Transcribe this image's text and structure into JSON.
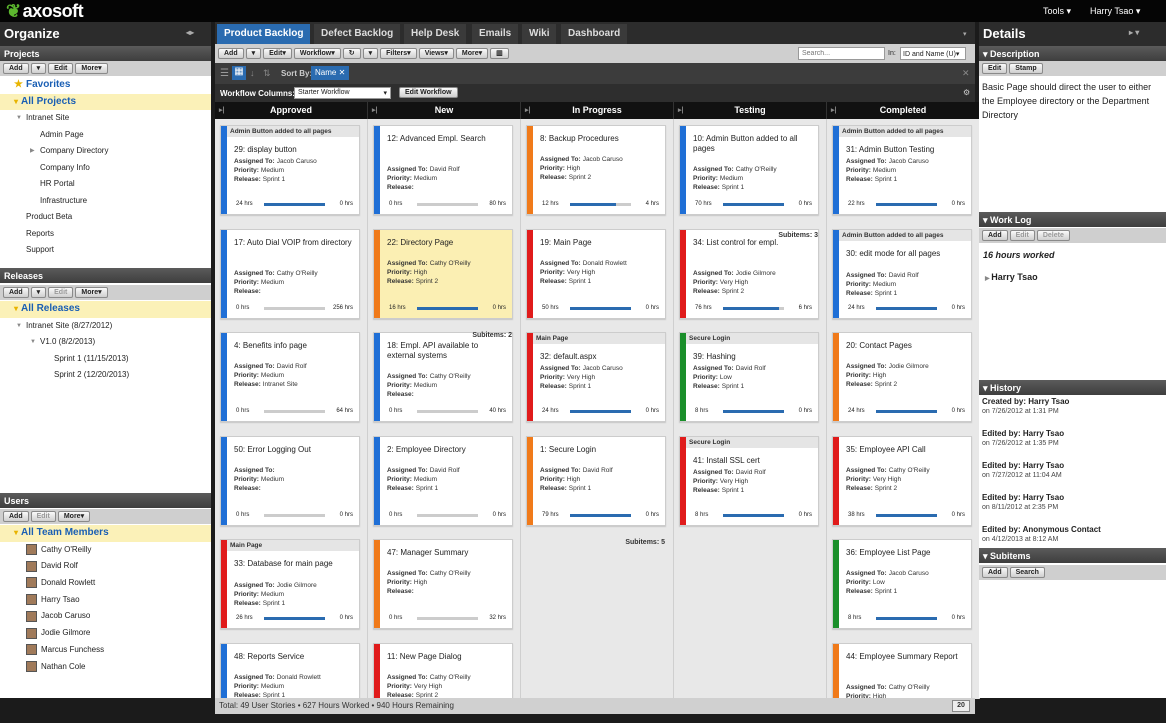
{
  "brand": {
    "name": "axosoft"
  },
  "top": {
    "tools": "Tools",
    "user": "Harry Tsao"
  },
  "organize": {
    "title": "Organize",
    "projects": {
      "title": "Projects",
      "add": "Add",
      "edit": "Edit",
      "more": "More",
      "items": [
        {
          "label": "Favorites",
          "level": 0,
          "style": "fav"
        },
        {
          "label": "All Projects",
          "level": 0,
          "style": "yel"
        },
        {
          "label": "Intranet Site",
          "level": 1
        },
        {
          "label": "Admin Page",
          "level": 2
        },
        {
          "label": "Company Directory",
          "level": 2
        },
        {
          "label": "Company Info",
          "level": 2
        },
        {
          "label": "HR Portal",
          "level": 2
        },
        {
          "label": "Infrastructure",
          "level": 2
        },
        {
          "label": "Product Beta",
          "level": 1
        },
        {
          "label": "Reports",
          "level": 1
        },
        {
          "label": "Support",
          "level": 1
        }
      ]
    },
    "releases": {
      "title": "Releases",
      "add": "Add",
      "edit": "Edit",
      "more": "More",
      "items": [
        {
          "label": "All Releases",
          "level": 0,
          "style": "yel"
        },
        {
          "label": "Intranet Site (8/27/2012)",
          "level": 1
        },
        {
          "label": "V1.0 (8/2/2013)",
          "level": 2
        },
        {
          "label": "Sprint 1 (11/15/2013)",
          "level": 3
        },
        {
          "label": "Sprint 2 (12/20/2013)",
          "level": 3
        }
      ]
    },
    "users": {
      "title": "Users",
      "add": "Add",
      "edit": "Edit",
      "more": "More",
      "items": [
        {
          "label": "All Team Members",
          "level": 0,
          "style": "yel"
        },
        {
          "label": "Cathy O'Reilly",
          "level": 1,
          "avatar": true
        },
        {
          "label": "David Rolf",
          "level": 1,
          "avatar": true
        },
        {
          "label": "Donald Rowlett",
          "level": 1,
          "avatar": true
        },
        {
          "label": "Harry Tsao",
          "level": 1,
          "avatar": true
        },
        {
          "label": "Jacob Caruso",
          "level": 1,
          "avatar": true
        },
        {
          "label": "Jodie Gilmore",
          "level": 1,
          "avatar": true
        },
        {
          "label": "Marcus Funchess",
          "level": 1,
          "avatar": true
        },
        {
          "label": "Nathan Cole",
          "level": 1,
          "avatar": true
        }
      ]
    }
  },
  "tabs": [
    "Product Backlog",
    "Defect Backlog",
    "Help Desk",
    "Emails",
    "Wiki",
    "Dashboard"
  ],
  "toolbar": {
    "add": "Add",
    "edit": "Edit",
    "workflow": "Workflow",
    "filters": "Filters",
    "views": "Views",
    "more": "More",
    "search_placeholder": "Search...",
    "in_label": "In:",
    "in_value": "ID and Name (U"
  },
  "sortbar": {
    "sort_by": "Sort By:",
    "sort_chip": "Name"
  },
  "workflow": {
    "label": "Workflow Columns:",
    "value": "Starter Workflow",
    "edit": "Edit Workflow"
  },
  "labels": {
    "assigned": "Assigned To:",
    "priority": "Priority:",
    "release": "Release:"
  },
  "columns": [
    {
      "name": "Approved",
      "cards": [
        {
          "tag": "Admin Button added to all pages",
          "title": "29: display button",
          "assigned": "Jacob Caruso",
          "priority": "Medium",
          "release": "Sprint 1",
          "left": "24 hrs",
          "right": "0 hrs",
          "pct": 100,
          "color": "#1f6fd6"
        },
        {
          "title": "17: Auto Dial VOIP from directory",
          "assigned": "Cathy O'Reilly",
          "priority": "Medium",
          "release": "",
          "left": "0 hrs",
          "right": "256 hrs",
          "pct": 0,
          "color": "#1f6fd6"
        },
        {
          "title": "4: Benefits info page",
          "assigned": "David Rolf",
          "priority": "Medium",
          "release": "Intranet Site",
          "left": "0 hrs",
          "right": "64 hrs",
          "pct": 0,
          "color": "#1f6fd6"
        },
        {
          "title": "50: Error Logging Out",
          "assigned": "",
          "priority": "Medium",
          "release": "",
          "left": "0 hrs",
          "right": "0 hrs",
          "pct": 0,
          "color": "#1f6fd6"
        },
        {
          "tag": "Main Page",
          "title": "33: Database for main page",
          "assigned": "Jodie Gilmore",
          "priority": "Medium",
          "release": "Sprint 1",
          "left": "26 hrs",
          "right": "0 hrs",
          "pct": 100,
          "color": "#e01b1b"
        },
        {
          "title": "48: Reports Service",
          "assigned": "Donald Rowlett",
          "priority": "Medium",
          "release": "Sprint 1",
          "left": "",
          "right": "",
          "pct": 0,
          "color": "#1f6fd6"
        }
      ]
    },
    {
      "name": "New",
      "cards": [
        {
          "title": "12: Advanced Empl. Search",
          "assigned": "David Rolf",
          "priority": "Medium",
          "release": "",
          "left": "0 hrs",
          "right": "80 hrs",
          "pct": 0,
          "color": "#1f6fd6"
        },
        {
          "title": "22: Directory Page",
          "assigned": "Cathy O'Reilly",
          "priority": "High",
          "release": "Sprint 2",
          "left": "16 hrs",
          "right": "0 hrs",
          "pct": 100,
          "color": "#f07a1a",
          "highlight": true
        },
        {
          "title": "18: Empl. API available to external systems",
          "assigned": "Cathy O'Reilly",
          "priority": "Medium",
          "release": "",
          "left": "0 hrs",
          "right": "40 hrs",
          "pct": 0,
          "color": "#1f6fd6"
        },
        {
          "title": "2: Employee Directory",
          "assigned": "David Rolf",
          "priority": "Medium",
          "release": "Sprint 1",
          "left": "0 hrs",
          "right": "0 hrs",
          "pct": 0,
          "color": "#1f6fd6"
        },
        {
          "title": "47: Manager Summary",
          "assigned": "Cathy O'Reilly",
          "priority": "High",
          "release": "",
          "left": "0 hrs",
          "right": "32 hrs",
          "pct": 0,
          "color": "#f07a1a"
        },
        {
          "title": "11: New Page Dialog",
          "assigned": "Cathy O'Reilly",
          "priority": "Very High",
          "release": "Sprint 2",
          "left": "",
          "right": "",
          "pct": 0,
          "color": "#e01b1b"
        }
      ]
    },
    {
      "name": "In Progress",
      "cards": [
        {
          "title": "8: Backup Procedures",
          "assigned": "Jacob Caruso",
          "priority": "High",
          "release": "Sprint 2",
          "left": "12 hrs",
          "right": "4 hrs",
          "pct": 75,
          "color": "#f07a1a"
        },
        {
          "title": "19: Main Page",
          "assigned": "Donald Rowlett",
          "priority": "Very High",
          "release": "Sprint 1",
          "left": "50 hrs",
          "right": "0 hrs",
          "pct": 100,
          "color": "#e01b1b"
        },
        {
          "tag": "Main Page",
          "title": "32: default.aspx",
          "assigned": "Jacob Caruso",
          "priority": "Very High",
          "release": "Sprint 1",
          "left": "24 hrs",
          "right": "0 hrs",
          "pct": 100,
          "color": "#e01b1b"
        },
        {
          "title": "1: Secure Login",
          "assigned": "David Rolf",
          "priority": "High",
          "release": "Sprint 1",
          "left": "79 hrs",
          "right": "0 hrs",
          "pct": 100,
          "color": "#f07a1a"
        }
      ]
    },
    {
      "name": "Testing",
      "cards": [
        {
          "title": "10: Admin Button added to all pages",
          "assigned": "Cathy O'Reilly",
          "priority": "Medium",
          "release": "Sprint 1",
          "left": "70 hrs",
          "right": "0 hrs",
          "pct": 100,
          "color": "#1f6fd6"
        },
        {
          "title": "34: List control for empl.",
          "assigned": "Jodie Gilmore",
          "priority": "Very High",
          "release": "Sprint 2",
          "left": "76 hrs",
          "right": "6 hrs",
          "pct": 92,
          "color": "#e01b1b"
        },
        {
          "tag": "Secure Login",
          "title": "39: Hashing",
          "assigned": "David Rolf",
          "priority": "Low",
          "release": "Sprint 1",
          "left": "8 hrs",
          "right": "0 hrs",
          "pct": 100,
          "color": "#1a8f2a"
        },
        {
          "tag": "Secure Login",
          "title": "41: Install SSL cert",
          "assigned": "David Rolf",
          "priority": "Very High",
          "release": "Sprint 1",
          "left": "8 hrs",
          "right": "0 hrs",
          "pct": 100,
          "color": "#e01b1b"
        }
      ]
    },
    {
      "name": "Completed",
      "cards": [
        {
          "tag": "Admin Button added to all pages",
          "title": "31: Admin Button Testing",
          "assigned": "Jacob Caruso",
          "priority": "Medium",
          "release": "Sprint 1",
          "left": "22 hrs",
          "right": "0 hrs",
          "pct": 100,
          "color": "#1f6fd6"
        },
        {
          "tag": "Admin Button added to all pages",
          "title": "30: edit mode for all pages",
          "assigned": "David Rolf",
          "priority": "Medium",
          "release": "Sprint 1",
          "left": "24 hrs",
          "right": "0 hrs",
          "pct": 100,
          "color": "#1f6fd6"
        },
        {
          "title": "20: Contact Pages",
          "assigned": "Jodie Gilmore",
          "priority": "High",
          "release": "Sprint 2",
          "left": "24 hrs",
          "right": "0 hrs",
          "pct": 100,
          "color": "#f07a1a"
        },
        {
          "title": "35: Employee API Call",
          "assigned": "Cathy O'Reilly",
          "priority": "Very High",
          "release": "Sprint 2",
          "left": "38 hrs",
          "right": "0 hrs",
          "pct": 100,
          "color": "#e01b1b"
        },
        {
          "title": "36: Employee List Page",
          "assigned": "Jacob Caruso",
          "priority": "Low",
          "release": "Sprint 1",
          "left": "8 hrs",
          "right": "0 hrs",
          "pct": 100,
          "color": "#1a8f2a"
        },
        {
          "title": "44: Employee Summary Report",
          "assigned": "Cathy O'Reilly",
          "priority": "High",
          "release": "",
          "left": "",
          "right": "",
          "pct": 0,
          "color": "#f07a1a"
        }
      ]
    }
  ],
  "subitems": [
    {
      "col": 3,
      "label": "Subitems: 3"
    },
    {
      "col": 2,
      "label": "Subitems: 2"
    },
    {
      "col": 1,
      "label": "Subitems: 5"
    }
  ],
  "status": {
    "text": "Total: 49 User Stories • 627 Hours Worked • 940 Hours Remaining",
    "page": "20"
  },
  "details": {
    "title": "Details",
    "description": {
      "title": "Description",
      "edit": "Edit",
      "stamp": "Stamp",
      "text": "Basic Page should direct the user to either the Employee directory or the Department Directory"
    },
    "worklog": {
      "title": "Work Log",
      "add": "Add",
      "edit": "Edit",
      "delete": "Delete",
      "summary": "16 hours worked",
      "person": "Harry Tsao"
    },
    "history": {
      "title": "History",
      "entries": [
        {
          "who": "Created by: Harry Tsao",
          "when": "on 7/26/2012 at 1:31 PM"
        },
        {
          "who": "Edited by: Harry Tsao",
          "when": "on 7/26/2012 at 1:35 PM"
        },
        {
          "who": "Edited by: Harry Tsao",
          "when": "on 7/27/2012 at 11:04 AM"
        },
        {
          "who": "Edited by: Harry Tsao",
          "when": "on 8/11/2012 at 2:35 PM"
        },
        {
          "who": "Edited by: Anonymous Contact",
          "when": "on 4/12/2013 at 8:12 AM"
        }
      ]
    },
    "subitems": {
      "title": "Subitems",
      "add": "Add",
      "search": "Search"
    }
  }
}
